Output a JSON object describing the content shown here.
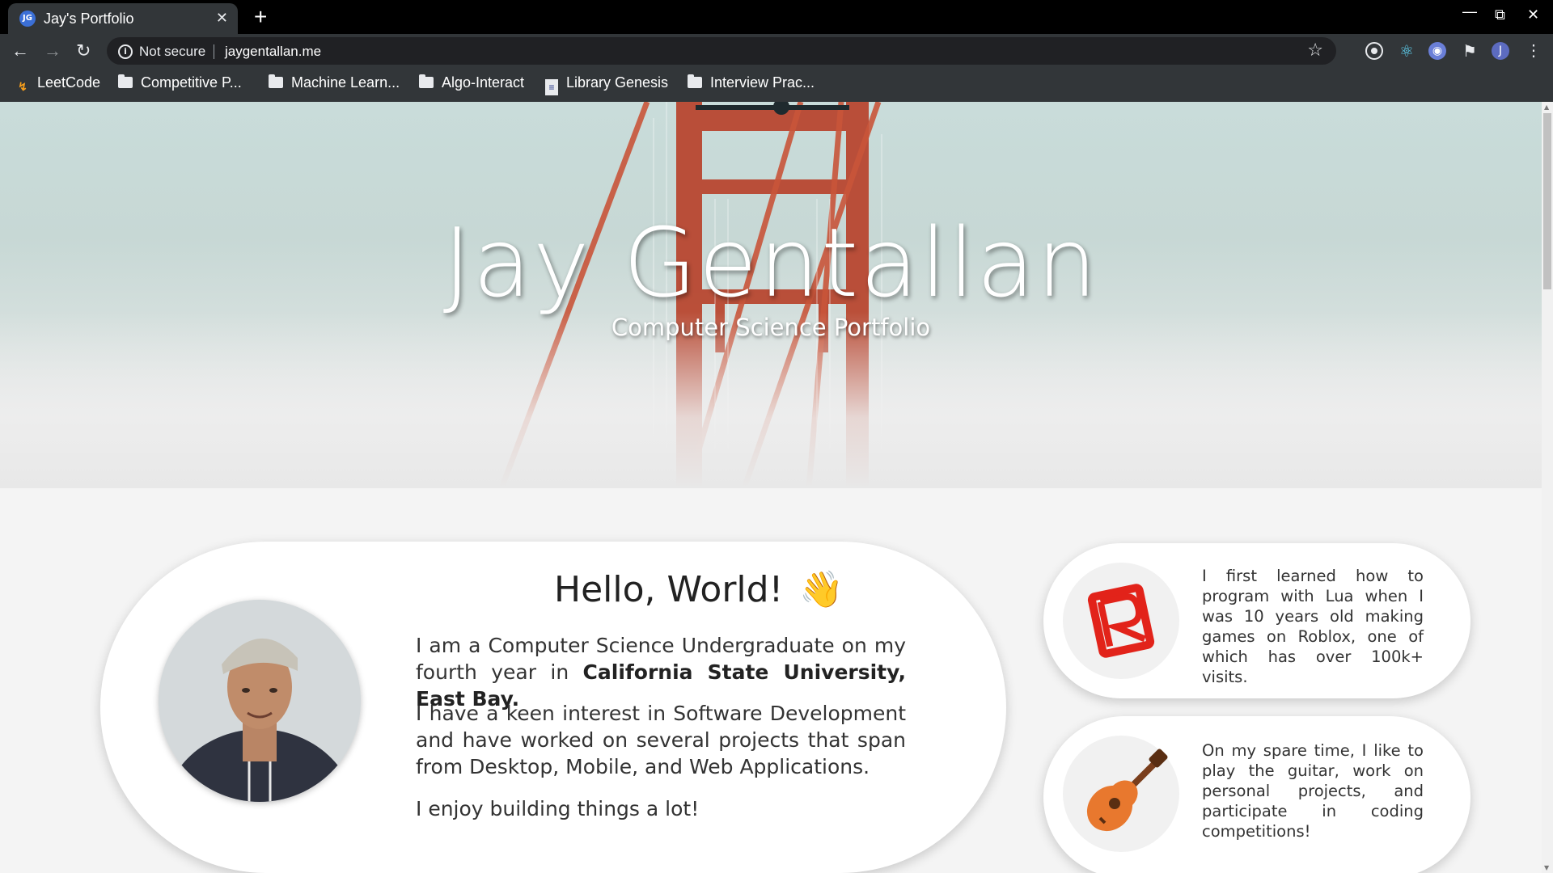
{
  "browser": {
    "tab_title": "Jay's Portfolio",
    "tab_favicon": "JG",
    "tab_close": "✕",
    "new_tab": "+",
    "security_label": "Not secure",
    "url": "jaygentallan.me",
    "extension_avatar": "J",
    "bookmarks": [
      {
        "label": "LeetCode",
        "icon": "leetcode-icon"
      },
      {
        "label": "Competitive P...",
        "icon": "folder-icon"
      },
      {
        "label": "Machine Learn...",
        "icon": "folder-icon"
      },
      {
        "label": "Algo-Interact",
        "icon": "folder-icon"
      },
      {
        "label": "Library Genesis",
        "icon": "libgen-icon"
      },
      {
        "label": "Interview Prac...",
        "icon": "folder-icon"
      }
    ]
  },
  "hero": {
    "title": "Jay Gentallan",
    "subtitle": "Computer Science Portfolio"
  },
  "intro": {
    "heading": "Hello, World!",
    "wave": "👋",
    "p1_text": "I am a Computer Science Undergraduate on my fourth year in ",
    "p1_bold": "California State University, East Bay.",
    "p2": "I have a keen interest in Software Development and have worked on several projects that span from Desktop, Mobile, and Web Applications.",
    "p3": "I enjoy building things a lot!"
  },
  "side_cards": [
    {
      "icon": "roblox-icon",
      "text": "I first learned how to program with Lua when I was 10 years old making games on Roblox, one of which has over 100k+ visits."
    },
    {
      "icon": "guitar-icon",
      "text": "On my spare time, I like to play the guitar, work on personal projects, and participate in coding competitions!"
    }
  ],
  "colors": {
    "browser_dark": "#323639",
    "roblox_red": "#e2231a",
    "bridge_red": "#c0452d"
  }
}
